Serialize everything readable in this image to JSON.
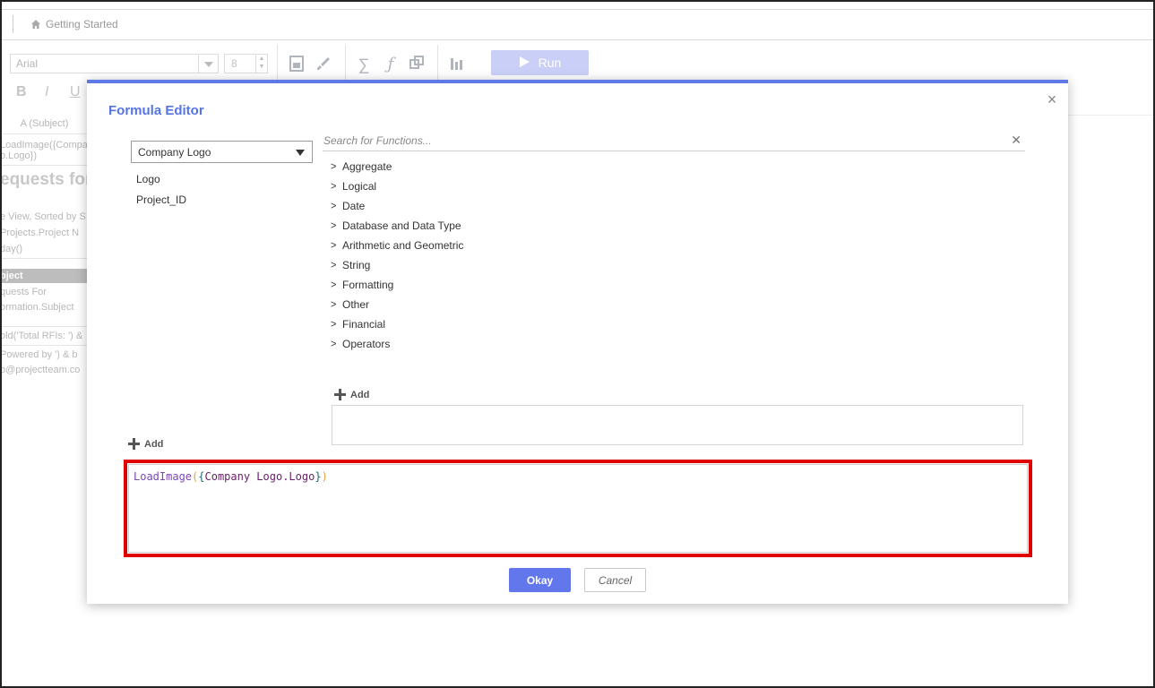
{
  "app": {
    "breadcrumb": "Getting Started",
    "toolbar": {
      "font_name": "Arial",
      "font_size": "8",
      "run_label": "Run",
      "bold": "B",
      "italic": "I",
      "underline": "U"
    },
    "sheet": {
      "column_header": "A (Subject)",
      "cell_formula_1": "LoadImage({Company",
      "cell_formula_2": "o.Logo})",
      "title": "equests for",
      "line_1": "e View, Sorted by S",
      "line_2": "Projects.Project N",
      "line_3": "day()",
      "band": "bject",
      "line_4": "quests For",
      "line_5": "ormation.Subject",
      "line_6": "old('Total RFIs: ') &",
      "line_7": "Powered by ') & b",
      "line_8": "o@projectteam.co"
    }
  },
  "dialog": {
    "title": "Formula Editor",
    "table_select": {
      "selected": "Company Logo"
    },
    "fields": [
      "Logo",
      "Project_ID"
    ],
    "search": {
      "placeholder": "Search for Functions...",
      "value": ""
    },
    "function_categories": [
      "Aggregate",
      "Logical",
      "Date",
      "Database and Data Type",
      "Arithmetic and Geometric",
      "String",
      "Formatting",
      "Other",
      "Financial",
      "Operators"
    ],
    "add_function_label": "Add",
    "add_field_label": "Add",
    "formula": {
      "function_name": "LoadImage",
      "open_paren": "(",
      "open_brace": "{",
      "reference": "Company Logo.Logo",
      "close_brace": "}",
      "close_paren": ")"
    },
    "okay_label": "Okay",
    "cancel_label": "Cancel"
  }
}
